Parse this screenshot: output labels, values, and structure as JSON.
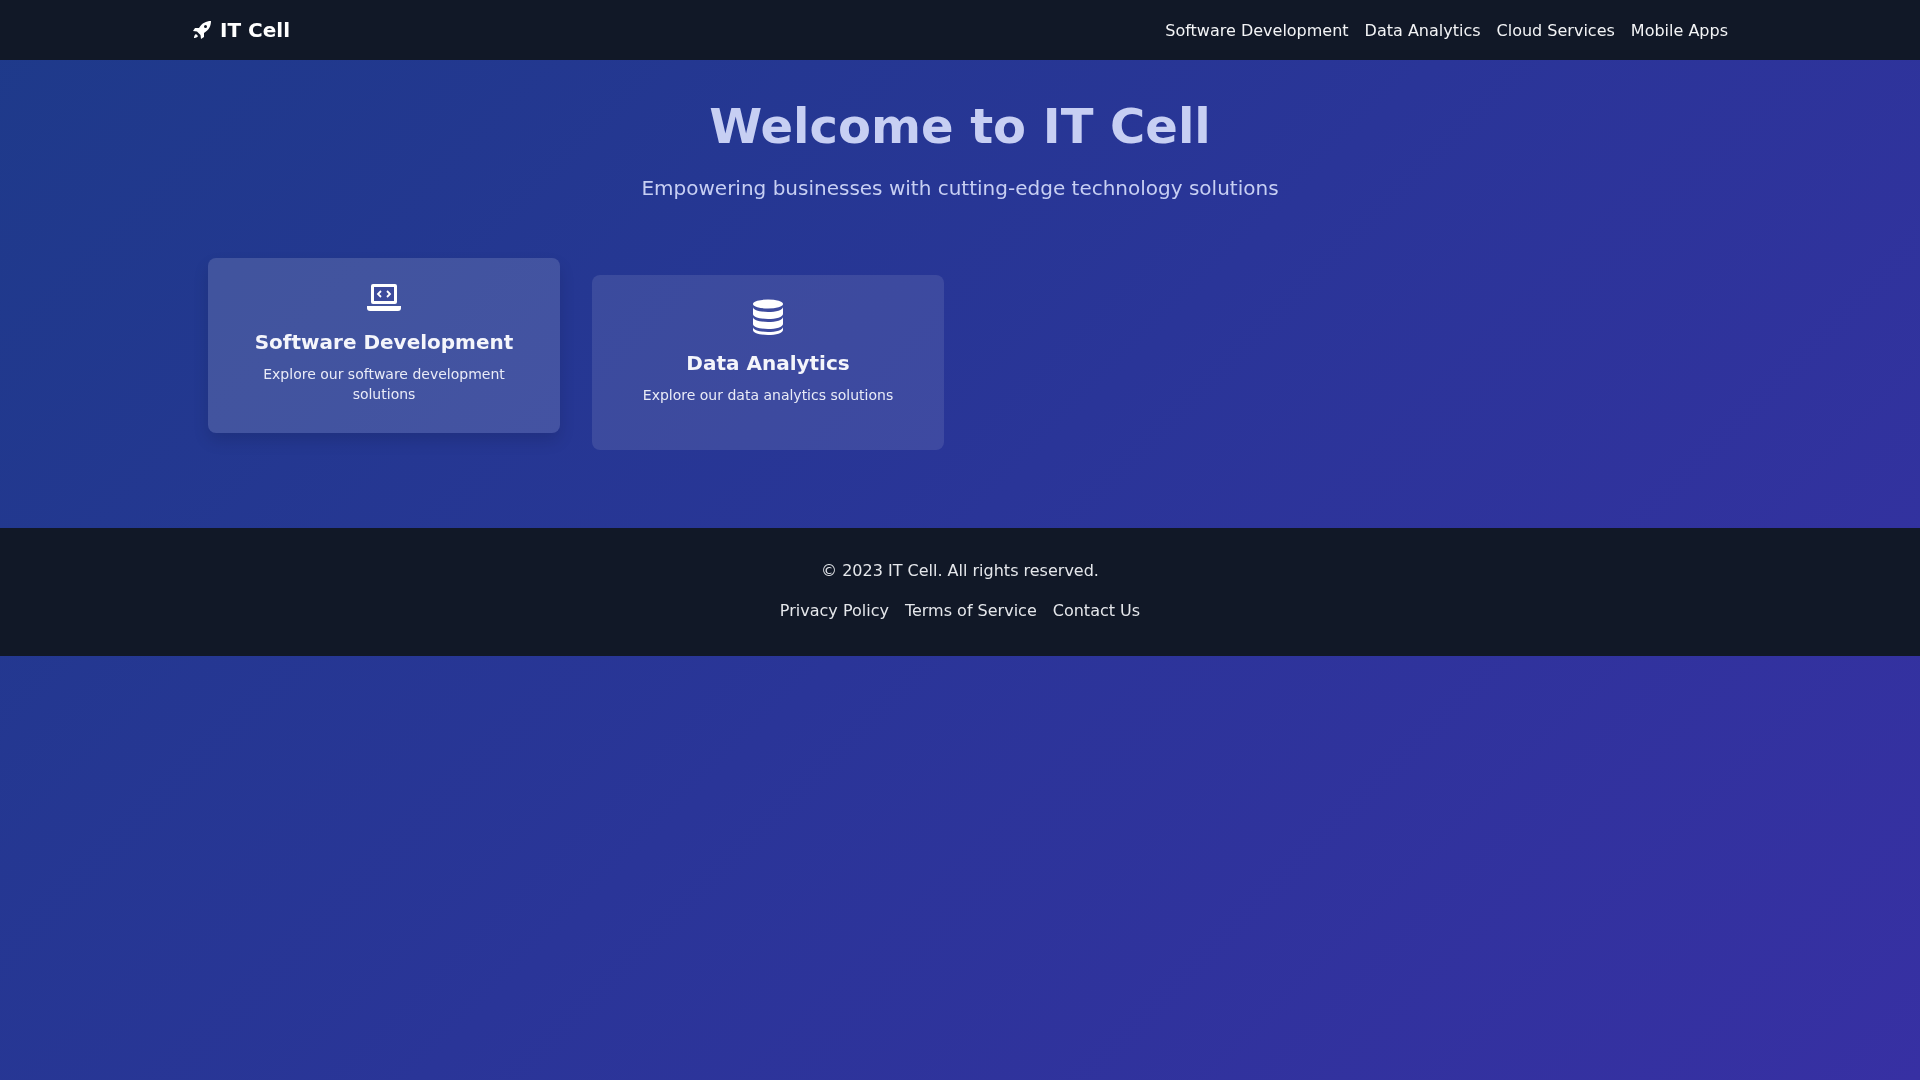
{
  "header": {
    "logo": "IT Cell",
    "nav": [
      {
        "label": "Software Development"
      },
      {
        "label": "Data Analytics"
      },
      {
        "label": "Cloud Services"
      },
      {
        "label": "Mobile Apps"
      }
    ]
  },
  "hero": {
    "title": "Welcome to IT Cell",
    "subtitle": "Empowering businesses with cutting-edge technology solutions"
  },
  "cards": [
    {
      "kind": "laptop",
      "title": "Software Development",
      "description": "Explore our software development solutions",
      "hovered": true
    },
    {
      "kind": "database",
      "title": "Data Analytics",
      "description": "Explore our data analytics solutions",
      "hovered": false
    }
  ],
  "footer": {
    "copyright": "© 2023 IT Cell. All rights reserved.",
    "links": [
      "Privacy Policy",
      "Terms of Service",
      "Contact Us"
    ]
  }
}
